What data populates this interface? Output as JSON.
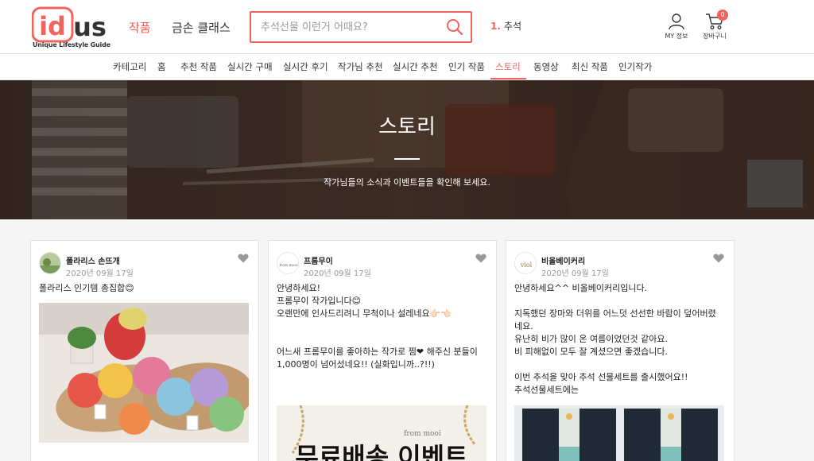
{
  "header": {
    "logo_text": "idus",
    "logo_tagline": "Unique Lifestyle Guide",
    "tabs": [
      {
        "label": "작품",
        "active": true
      },
      {
        "label": "금손 클래스",
        "active": false
      }
    ],
    "search_placeholder": "추석선물 이런거 어때요?",
    "rank": {
      "num": "1.",
      "keyword": "추석"
    },
    "my_label": "MY 정보",
    "cart_label": "장바구니",
    "cart_count": "0"
  },
  "subnav": {
    "items": [
      "카테고리",
      "홈",
      "추천 작품",
      "실시간 구매",
      "실시간 후기",
      "작가님 추천",
      "실시간 추천",
      "인기 작품",
      "스토리",
      "동영상",
      "최신 작품",
      "인기작가"
    ],
    "active_index": 8
  },
  "hero": {
    "title": "스토리",
    "subtitle": "작가님들의 소식과 이벤트들을 확인해 보세요."
  },
  "cards": [
    {
      "author": "폴라리스 손뜨개",
      "date": "2020년 09월 17일",
      "lines": [
        "폴라리스 인기템 총집합😊"
      ]
    },
    {
      "author": "프롬무이",
      "avatar_text": "from mooi",
      "date": "2020년 09월 17일",
      "lines": [
        "안녕하세요!",
        "프롬무이 작가입니다😊",
        "오랜만에 인사드리려니 무척이나 설레네요👉🏻👈🏻",
        "",
        "",
        "어느새 프롬무이를 좋아하는 작가로 찜❤ 해주신 분들이",
        "1,000명이 넘어섰네요!! (실화입니까..?!!)"
      ],
      "banner_text": "무료배송 이벤트",
      "banner_small": "from mooi"
    },
    {
      "author": "비올베이커리",
      "avatar_text": "viol",
      "date": "2020년 09월 17일",
      "lines": [
        "안녕하세요^^ 비올베이커리입니다.",
        "",
        "지독했던 장마와 더위를 어느덧 선선한 바람이 덮어버렸",
        "네요.",
        "유난히 비가 많이 온 여름이었던것 같아요.",
        "비 피해없이 모두 잘 계셨으면 좋겠습니다.",
        "",
        "이번 추석을 맞아 추석 선물세트를 출시했어요!!",
        "추석선물세트에는"
      ]
    }
  ],
  "colors": {
    "brand": "#f1645d"
  }
}
